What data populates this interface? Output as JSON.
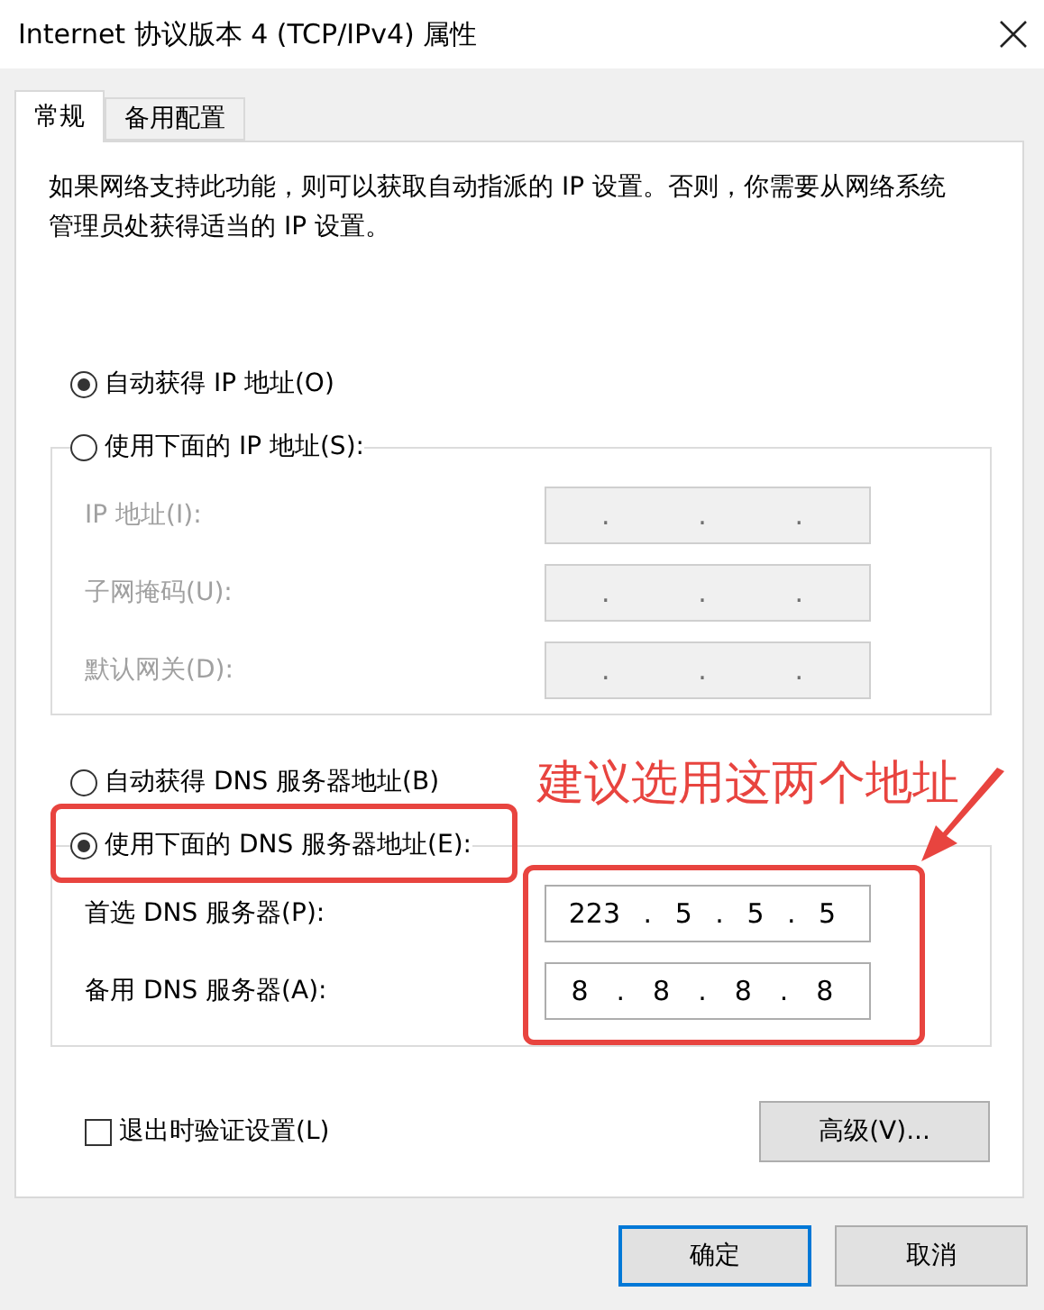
{
  "window": {
    "title": "Internet 协议版本 4 (TCP/IPv4) 属性"
  },
  "tabs": [
    {
      "label": "常规",
      "selected": true
    },
    {
      "label": "备用配置",
      "selected": false
    }
  ],
  "description": "如果网络支持此功能，则可以获取自动指派的 IP 设置。否则，你需要从网络系统管理员处获得适当的 IP 设置。",
  "ip_section": {
    "auto_option": {
      "label": "自动获得 IP 地址(O)",
      "selected": true
    },
    "manual_option": {
      "label": "使用下面的 IP 地址(S):",
      "selected": false
    },
    "disabled": true,
    "fields": [
      {
        "label": "IP 地址(I):",
        "value": ". . ."
      },
      {
        "label": "子网掩码(U):",
        "value": ". . ."
      },
      {
        "label": "默认网关(D):",
        "value": ". . ."
      }
    ]
  },
  "dns_section": {
    "auto_option": {
      "label": "自动获得 DNS 服务器地址(B)",
      "selected": false
    },
    "manual_option": {
      "label": "使用下面的 DNS 服务器地址(E):",
      "selected": true
    },
    "disabled": false,
    "fields": [
      {
        "label": "首选 DNS 服务器(P):",
        "value": "223 . 5 . 5 . 5"
      },
      {
        "label": "备用 DNS 服务器(A):",
        "value": "8 . 8 . 8 . 8"
      }
    ]
  },
  "validate_checkbox": {
    "label": "退出时验证设置(L)",
    "checked": false
  },
  "advanced_button": "高级(V)...",
  "buttons": [
    {
      "label": "确定",
      "default": true
    },
    {
      "label": "取消",
      "default": false
    }
  ],
  "annotation": {
    "text": "建议选用这两个地址"
  }
}
